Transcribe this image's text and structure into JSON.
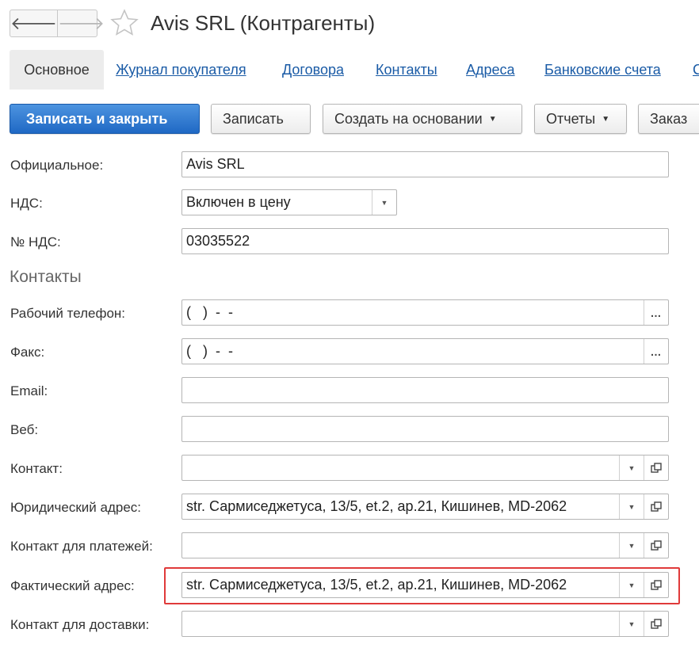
{
  "header": {
    "back_icon": "arrow-left-icon",
    "forward_icon": "arrow-right-icon",
    "favorite_icon": "star-icon",
    "title": "Avis SRL (Контрагенты)"
  },
  "tabs": [
    {
      "label": "Основное",
      "active": true
    },
    {
      "label": "Журнал покупателя"
    },
    {
      "label": "Договора"
    },
    {
      "label": "Контакты"
    },
    {
      "label": "Адреса"
    },
    {
      "label": "Банковские счета"
    },
    {
      "label": "С"
    }
  ],
  "toolbar": {
    "save_close": "Записать и закрыть",
    "save": "Записать",
    "create_based": "Создать на основании",
    "reports": "Отчеты",
    "order": "Заказ"
  },
  "form": {
    "official_label": "Официальное:",
    "official_value": "Avis SRL",
    "vat_label": "НДС:",
    "vat_value": "Включен в цену",
    "vat_number_label": "№ НДС:",
    "vat_number_value": "03035522",
    "contacts_section": "Контакты",
    "work_phone_label": "Рабочий телефон:",
    "work_phone_value": "(   )  -  -",
    "fax_label": "Факс:",
    "fax_value": "(   )  -  -",
    "email_label": "Email:",
    "email_value": "",
    "web_label": "Веб:",
    "web_value": "",
    "contact_label": "Контакт:",
    "contact_value": "",
    "legal_address_label": "Юридический адрес:",
    "legal_address_value": "str. Сармиседжетуса, 13/5, et.2, ap.21, Кишинев, MD-2062",
    "payment_contact_label": "Контакт для платежей:",
    "payment_contact_value": "",
    "actual_address_label": "Фактический адрес:",
    "actual_address_value": "str. Сармиседжетуса, 13/5, et.2, ap.21, Кишинев, MD-2062",
    "delivery_contact_label": "Контакт для доставки:",
    "delivery_contact_value": ""
  },
  "colors": {
    "primary": "#1f68c4",
    "link": "#1a5ba6",
    "highlight": "#e03a3a"
  }
}
